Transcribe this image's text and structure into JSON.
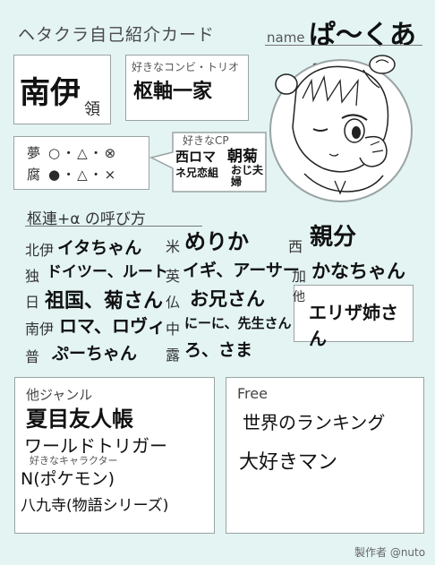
{
  "header": {
    "title": "ヘタクラ自己紹介カード",
    "name_label": "name",
    "name_value": "ぱ〜くあめ"
  },
  "profile": {
    "character": "南伊",
    "character_suffix": "領",
    "combi_label": "好きなコンビ・トリオ",
    "combi_value": "枢軸一家",
    "dream_label": "夢",
    "dream_symbols": "○・△・⊗",
    "fujo_label": "腐",
    "fujo_symbols": "●・△・×",
    "cp_label": "好きなCP",
    "cp_value_1": "西ロマ",
    "cp_value_2": "朝菊",
    "cp_value_3": "ネ兄恋組",
    "cp_value_4": "おじ夫婦"
  },
  "nicknames": {
    "heading": "枢連+α の呼び方",
    "items": [
      {
        "country": "北伊",
        "name": "イタちゃん"
      },
      {
        "country": "米",
        "name": "めりか"
      },
      {
        "country": "西",
        "name": "親分"
      },
      {
        "country": "独",
        "name": "ドイツー、ルート"
      },
      {
        "country": "英",
        "name": "イギ、アーサー"
      },
      {
        "country": "加",
        "name": "かなちゃん"
      },
      {
        "country": "日",
        "name": "祖国、菊さん"
      },
      {
        "country": "仏",
        "name": "お兄さん"
      },
      {
        "country": "南伊",
        "name": "ロマ、ロヴィ"
      },
      {
        "country": "中",
        "name": "にーに、先生さん"
      },
      {
        "country": "普",
        "name": "ぷーちゃん"
      },
      {
        "country": "露",
        "name": "ろ、さま"
      }
    ],
    "other_label": "他",
    "other_value": "エリザ姉さん"
  },
  "genres": {
    "label": "他ジャンル",
    "items": [
      "夏目友人帳",
      "ワールドトリガー"
    ],
    "chara_label": "好きなキャラクター",
    "chara_items": [
      "N(ポケモン)",
      "八九寺(物語シリーズ)"
    ]
  },
  "free": {
    "label": "Free",
    "text_1": "世界のランキング",
    "text_2": "大好きマン"
  },
  "footer": {
    "credit": "製作者 @nuto"
  }
}
